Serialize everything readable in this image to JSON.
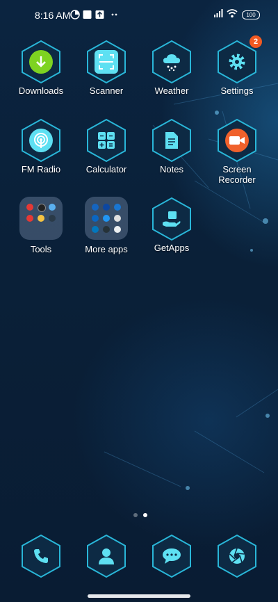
{
  "status_bar": {
    "time": "8:16 AM",
    "battery": "100"
  },
  "apps": [
    {
      "label": "Downloads"
    },
    {
      "label": "Scanner"
    },
    {
      "label": "Weather"
    },
    {
      "label": "Settings",
      "badge": "2"
    },
    {
      "label": "FM Radio"
    },
    {
      "label": "Calculator"
    },
    {
      "label": "Notes"
    },
    {
      "label": "Screen Recorder",
      "label_line1": "Screen",
      "label_line2": "Recorder"
    },
    {
      "label": "Tools"
    },
    {
      "label": "More apps"
    },
    {
      "label": "GetApps"
    }
  ],
  "dock": [
    {
      "icon": "phone-icon"
    },
    {
      "icon": "contacts-icon"
    },
    {
      "icon": "messages-icon"
    },
    {
      "icon": "camera-icon"
    }
  ],
  "colors": {
    "hex_outline": "#29b6d8",
    "accent_cyan": "#5ee0f2",
    "downloads_green": "#7ed321",
    "recorder_orange": "#f0612c",
    "badge": "#f15a22"
  }
}
